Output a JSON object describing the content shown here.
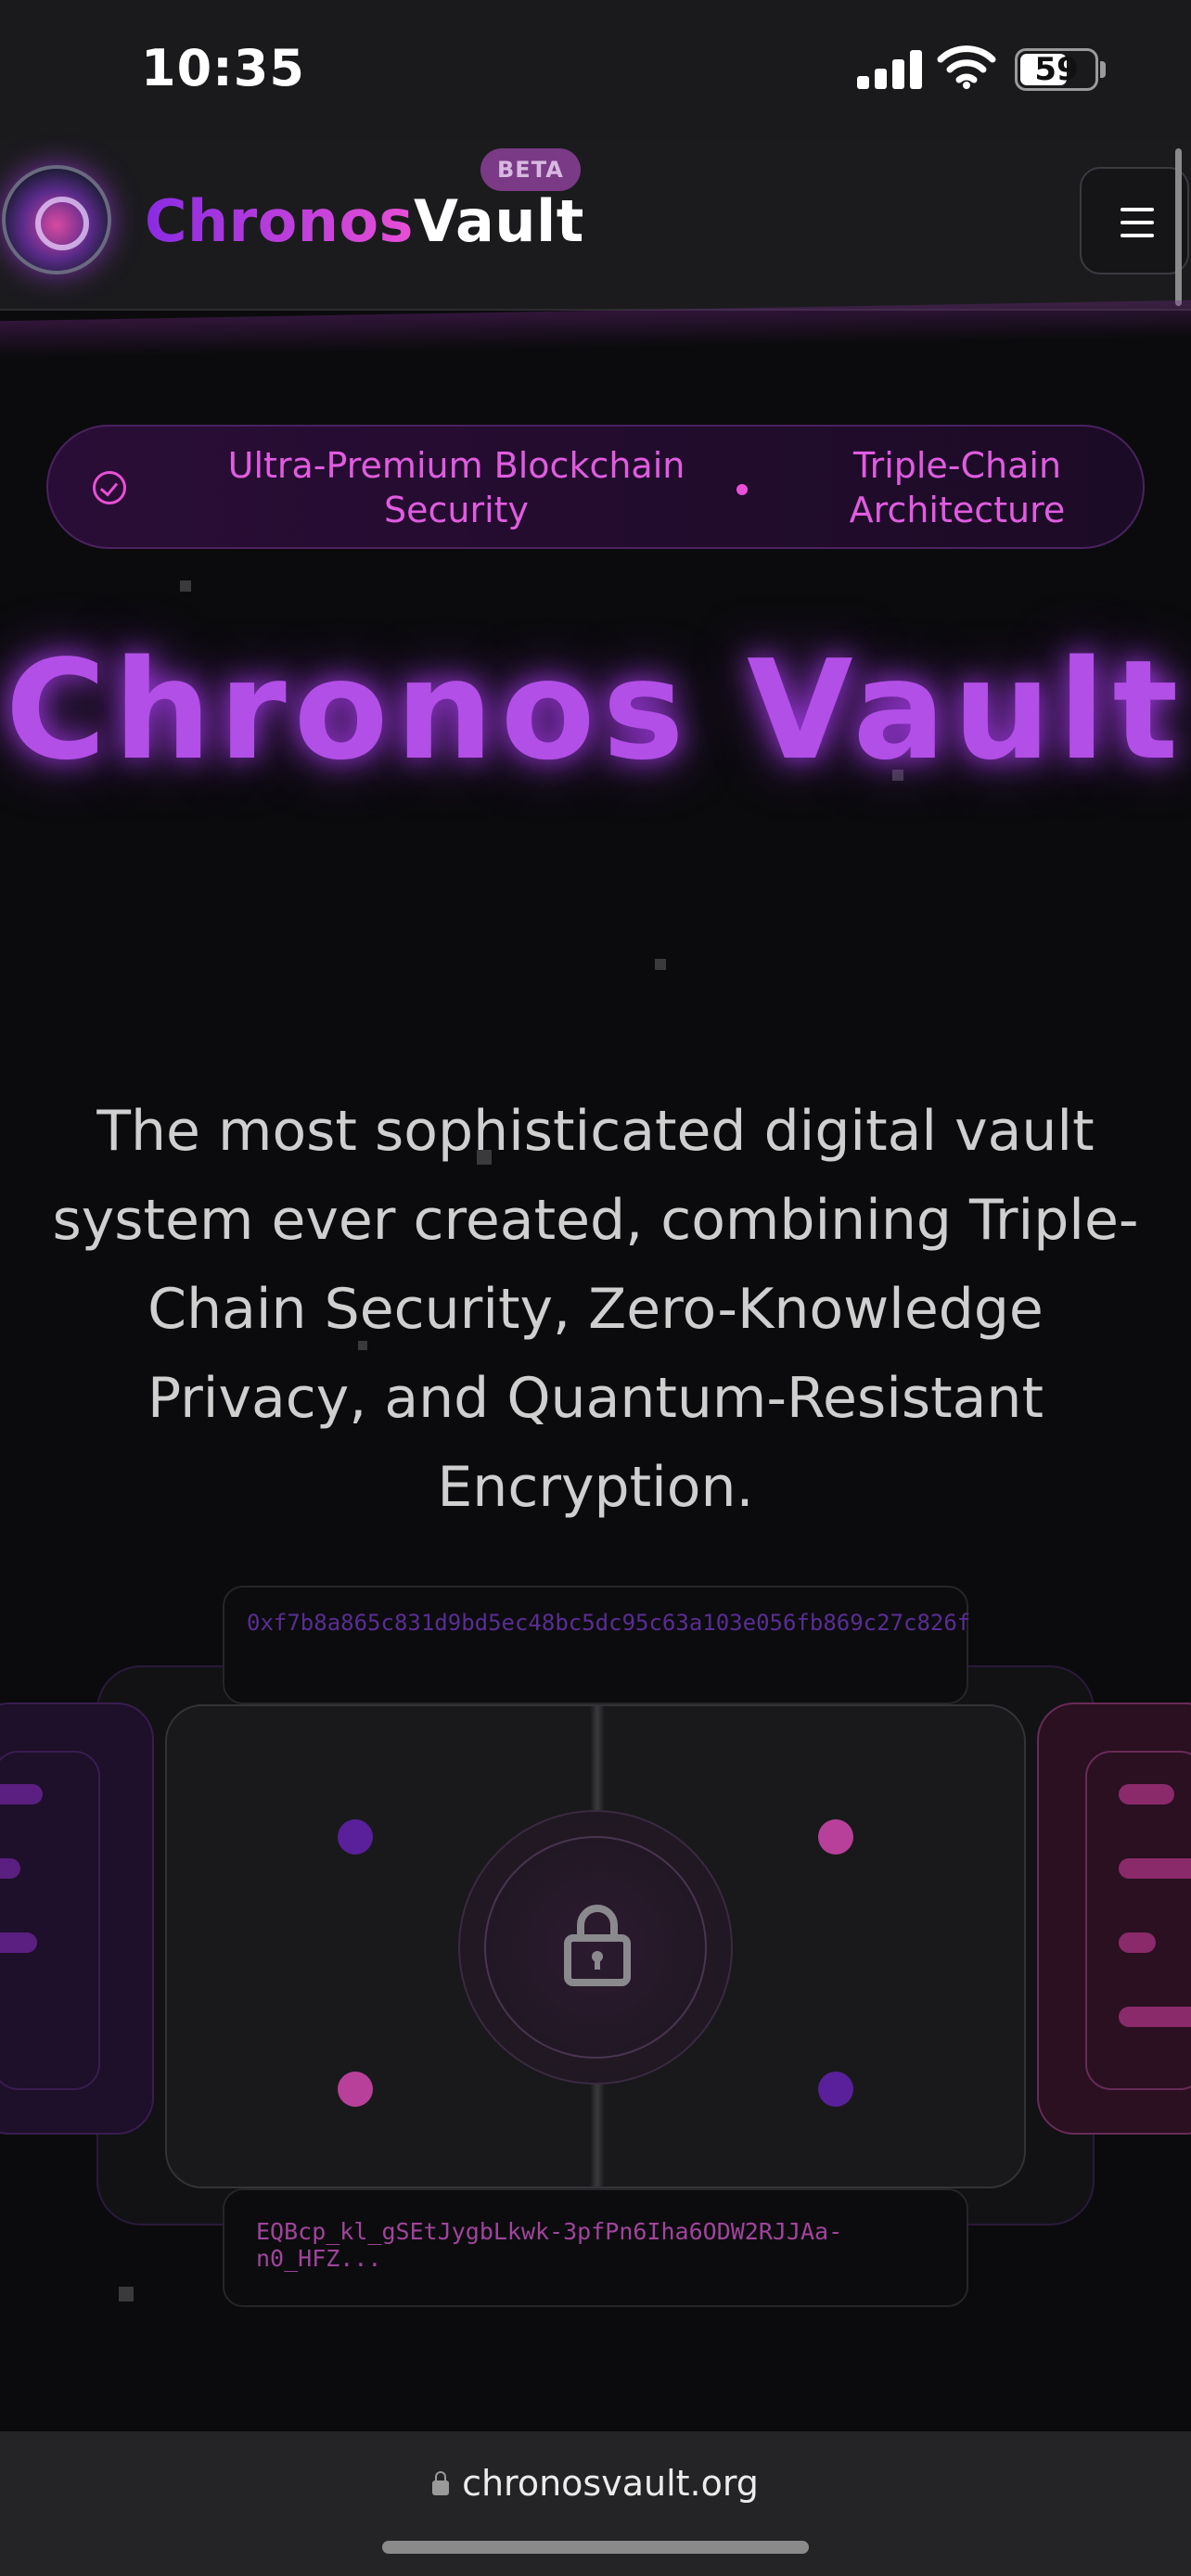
{
  "status_bar": {
    "time": "10:35",
    "battery": "59",
    "icons": [
      "signal-icon",
      "wifi-icon",
      "battery-icon"
    ]
  },
  "header": {
    "brand_part1": "Chronos",
    "brand_part2": "Vault",
    "beta_badge": "BETA",
    "menu_icon": "hamburger-menu-icon"
  },
  "hero": {
    "badge_feature_1": "Ultra-Premium Blockchain Security",
    "badge_feature_2": "Triple-Chain Architecture",
    "badge_icon": "verified-check-icon",
    "title": "Chronos Vault",
    "description": "The most sophisticated digital vault system ever created, combining Triple-Chain Security, Zero-Knowledge Privacy, and Quantum-Resistant Encryption."
  },
  "vault_visual": {
    "address_top": "0xf7b8a865c831d9bd5ec48bc5dc95c63a103e056fb869c27c826f",
    "address_bottom": "EQBcp_kl_gSEtJygbLkwk-3pfPn6Iha6ODW2RJJAa-n0_HFZ...",
    "center_icon": "lock-icon"
  },
  "browser": {
    "url": "chronosvault.org",
    "url_icon": "padlock-icon"
  },
  "colors": {
    "accent_purple": "#8a2be2",
    "accent_pink": "#e84fd6",
    "background": "#0b0b0d"
  }
}
